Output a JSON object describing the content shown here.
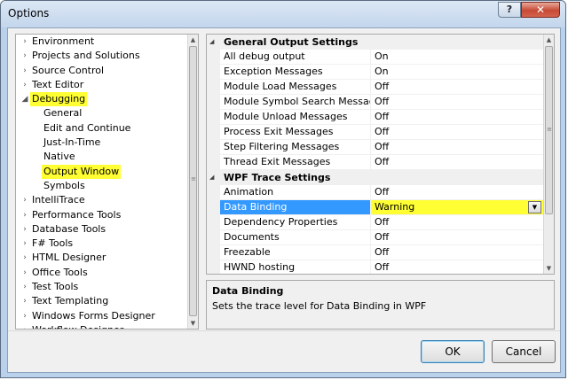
{
  "window": {
    "title": "Options",
    "help_label": "?",
    "close_label": "✕"
  },
  "tree": {
    "items": [
      {
        "label": "Environment",
        "level": 0,
        "expanded": false
      },
      {
        "label": "Projects and Solutions",
        "level": 0,
        "expanded": false
      },
      {
        "label": "Source Control",
        "level": 0,
        "expanded": false
      },
      {
        "label": "Text Editor",
        "level": 0,
        "expanded": false
      },
      {
        "label": "Debugging",
        "level": 0,
        "expanded": true,
        "highlighted": true
      },
      {
        "label": "General",
        "level": 1
      },
      {
        "label": "Edit and Continue",
        "level": 1
      },
      {
        "label": "Just-In-Time",
        "level": 1
      },
      {
        "label": "Native",
        "level": 1
      },
      {
        "label": "Output Window",
        "level": 1,
        "highlighted": true
      },
      {
        "label": "Symbols",
        "level": 1
      },
      {
        "label": "IntelliTrace",
        "level": 0,
        "expanded": false
      },
      {
        "label": "Performance Tools",
        "level": 0,
        "expanded": false
      },
      {
        "label": "Database Tools",
        "level": 0,
        "expanded": false
      },
      {
        "label": "F# Tools",
        "level": 0,
        "expanded": false
      },
      {
        "label": "HTML Designer",
        "level": 0,
        "expanded": false
      },
      {
        "label": "Office Tools",
        "level": 0,
        "expanded": false
      },
      {
        "label": "Test Tools",
        "level": 0,
        "expanded": false
      },
      {
        "label": "Text Templating",
        "level": 0,
        "expanded": false
      },
      {
        "label": "Windows Forms Designer",
        "level": 0,
        "expanded": false
      },
      {
        "label": "Workflow Designer",
        "level": 0,
        "expanded": false
      }
    ]
  },
  "grid": {
    "categories": [
      {
        "label": "General Output Settings",
        "rows": [
          {
            "name": "All debug output",
            "value": "On"
          },
          {
            "name": "Exception Messages",
            "value": "On"
          },
          {
            "name": "Module Load Messages",
            "value": "Off"
          },
          {
            "name": "Module Symbol Search Messages",
            "value": "Off"
          },
          {
            "name": "Module Unload Messages",
            "value": "Off"
          },
          {
            "name": "Process Exit Messages",
            "value": "Off"
          },
          {
            "name": "Step Filtering Messages",
            "value": "Off"
          },
          {
            "name": "Thread Exit Messages",
            "value": "Off"
          }
        ]
      },
      {
        "label": "WPF Trace Settings",
        "rows": [
          {
            "name": "Animation",
            "value": "Off"
          },
          {
            "name": "Data Binding",
            "value": "Warning",
            "selected": true
          },
          {
            "name": "Dependency Properties",
            "value": "Off"
          },
          {
            "name": "Documents",
            "value": "Off"
          },
          {
            "name": "Freezable",
            "value": "Off"
          },
          {
            "name": "HWND hosting",
            "value": "Off"
          }
        ]
      }
    ]
  },
  "description": {
    "title": "Data Binding",
    "text": "Sets the trace level for Data Binding in WPF"
  },
  "buttons": {
    "ok_label": "OK",
    "cancel_label": "Cancel"
  },
  "colors": {
    "highlight": "#ffff33",
    "selection": "#3399ff"
  }
}
